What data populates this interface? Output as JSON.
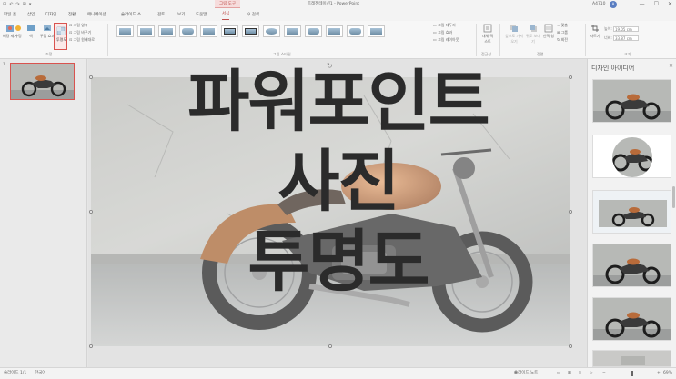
{
  "titlebar": {
    "qat_items": [
      "⊟",
      "↶",
      "↷",
      "⊞",
      "▾"
    ],
    "context_tools": "그림 도구",
    "document_title": "트레젠테이션1 - PowerPoint",
    "user_name": "A4710",
    "avatar_initial": "A",
    "win_minimize": "—",
    "win_maximize": "☐",
    "win_close": "✕"
  },
  "tabs": [
    {
      "label": "파일",
      "active": false
    },
    {
      "label": "홈",
      "active": false
    },
    {
      "label": "삽입",
      "active": false
    },
    {
      "label": "디자인",
      "active": false
    },
    {
      "label": "전환",
      "active": false
    },
    {
      "label": "애니메이션",
      "active": false
    },
    {
      "label": "슬라이드 쇼",
      "active": false
    },
    {
      "label": "검토",
      "active": false
    },
    {
      "label": "보기",
      "active": false
    },
    {
      "label": "도움말",
      "active": false
    },
    {
      "label": "서식",
      "active": true
    }
  ],
  "search_tab": "검색",
  "ribbon": {
    "adjust": {
      "remove_bg": "배경 제거",
      "corrections": "수정",
      "color": "색",
      "artistic": "꾸밈 효과",
      "transparency": "투명도",
      "compress": "그림 압축",
      "change": "그림 바꾸기",
      "reset": "그림 원래대로",
      "group_label": "조정"
    },
    "styles_group_label": "그림 스타일",
    "picture_border": "그림 테두리",
    "picture_effects": "그림 효과",
    "picture_layout": "그림 레이아웃",
    "alt_text": "대체 텍스트",
    "accessibility_label": "접근성",
    "bring_forward": "앞으로 가져오기",
    "send_backward": "뒤로 보내기",
    "selection_pane": "선택 창",
    "align": "맞춤",
    "group": "그룹",
    "rotate": "회전",
    "arrange_label": "정렬",
    "crop": "자르기",
    "height_label": "높이:",
    "height_value": "19.05 cm",
    "width_label": "너비:",
    "width_value": "33.87 cm",
    "size_label": "크기"
  },
  "slide_pane": {
    "slide_number": "1"
  },
  "slide": {
    "overlay_lines": [
      "파워포인트",
      "사진",
      "투명도"
    ]
  },
  "design_pane": {
    "title": "디자인 아이디어",
    "close": "✕"
  },
  "statusbar": {
    "slide_info": "슬라이드 1/1",
    "language": "한국어",
    "notes": "슬라이드 노트",
    "zoom": "69%"
  },
  "colors": {
    "accent": "#c0504d",
    "ribbon_bg": "#f7f7f7",
    "slide_text": "#2b2b2b"
  }
}
